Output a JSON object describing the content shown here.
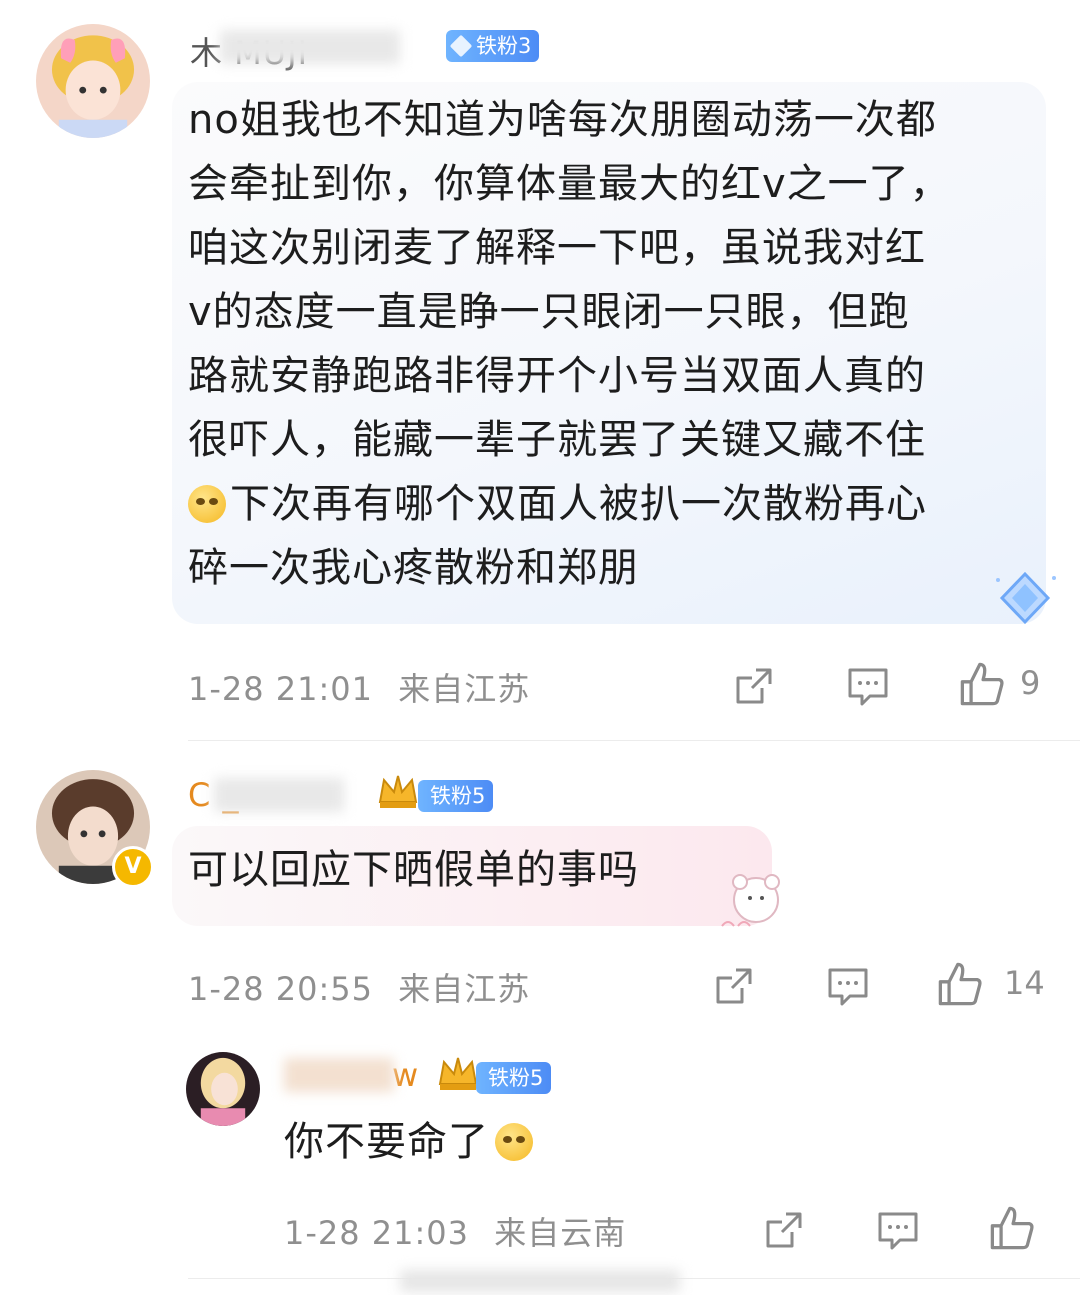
{
  "comments": [
    {
      "username": "木 MUJI",
      "badge": "铁粉3",
      "text_lines": [
        "no姐我也不知道为啥每次朋圈动荡一次都",
        "会牵扯到你，你算体量最大的红v之一了，",
        "咱这次别闭麦了解释一下吧，虽说我对红",
        "v的态度一直是睁一只眼闭一只眼，但跑",
        "路就安静跑路非得开个小号当双面人真的",
        "很吓人，能藏一辈子就罢了关键又藏不住",
        "下次再有哪个双面人被扒一次散粉再心",
        "碎一次我心疼散粉和郑朋"
      ],
      "time": "1-28 21:01",
      "location": "来自江苏",
      "likes": "9"
    },
    {
      "username": "C _",
      "badge": "铁粉5",
      "text_lines": [
        "可以回应下晒假单的事吗"
      ],
      "time": "1-28 20:55",
      "location": "来自江苏",
      "likes": "14"
    },
    {
      "username": "w",
      "badge": "铁粉5",
      "text_lines": [
        "你不要命了"
      ],
      "time": "1-28 21:03",
      "location": "来自云南",
      "likes": ""
    }
  ],
  "icons": {
    "repost": "share-square-icon",
    "comment": "comment-bubble-icon",
    "like": "thumbs-up-icon"
  },
  "colors": {
    "badge_blue": "#4d8cf5",
    "meta_gray": "#8f8f8f"
  }
}
